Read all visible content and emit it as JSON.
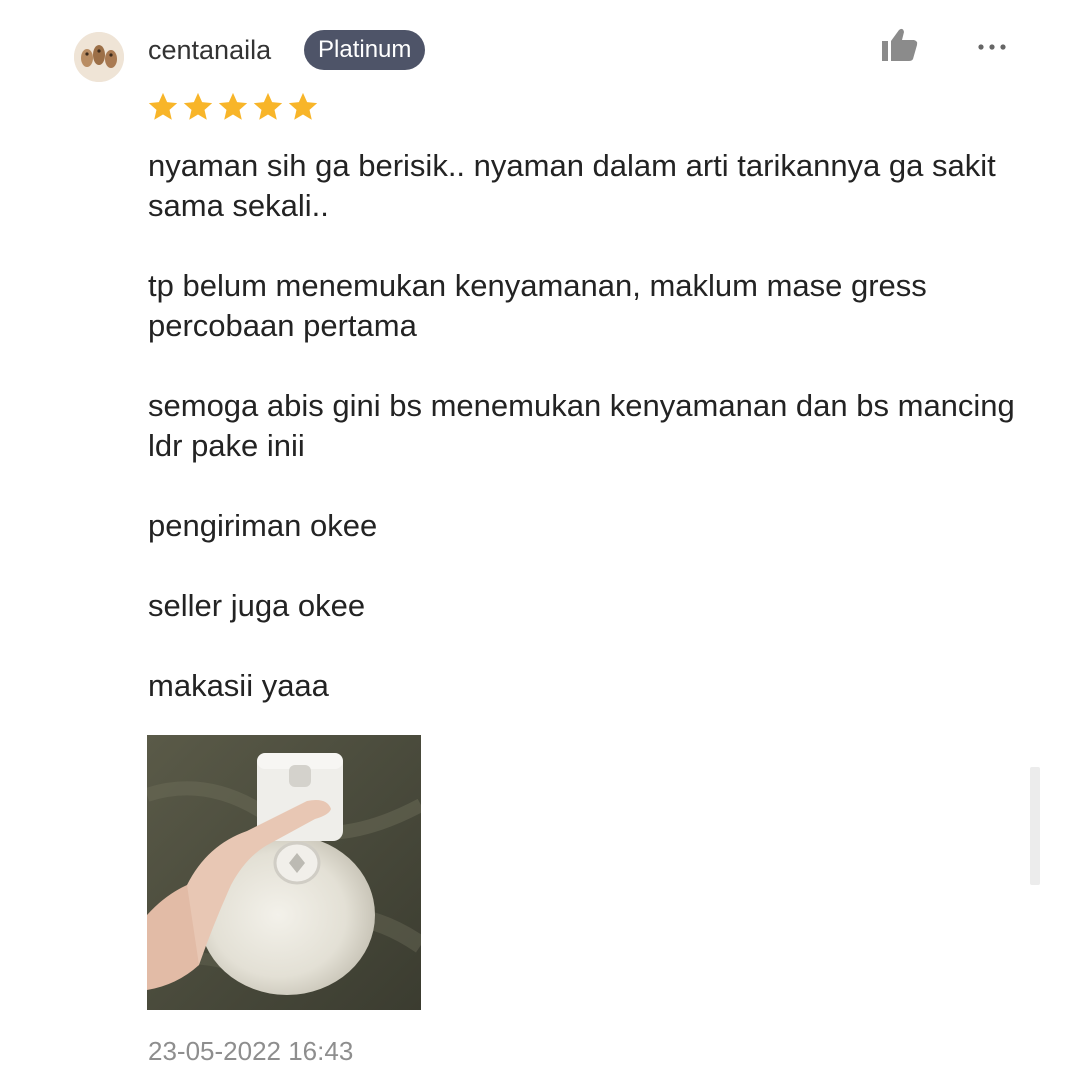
{
  "review": {
    "username": "centanaila",
    "badge": "Platinum",
    "rating": 5,
    "paragraphs": [
      "nyaman sih ga berisik.. nyaman dalam arti tarikannya ga sakit sama sekali..",
      "tp belum menemukan kenyamanan, maklum mase gress percobaan pertama",
      "semoga abis gini bs menemukan kenyamanan dan bs mancing ldr pake inii",
      "pengiriman okee",
      "seller juga okee",
      "makasii yaaa"
    ],
    "timestamp": "23-05-2022 16:43"
  },
  "icons": {
    "like": "thumbs-up-icon",
    "more": "more-dots-icon",
    "star": "star-icon"
  },
  "colors": {
    "badge_bg": "#4e5468",
    "star": "#f8b529",
    "text": "#232323",
    "muted": "#8e8e8e"
  }
}
